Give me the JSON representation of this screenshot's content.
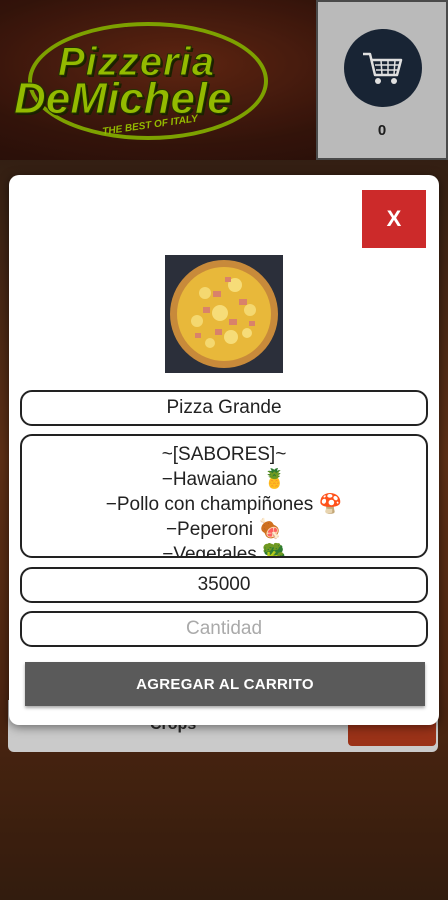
{
  "header": {
    "logo_line1": "Pizzeria",
    "logo_line2": "DeMichele",
    "logo_tagline": "THE BEST OF ITALY",
    "cart_count": "0"
  },
  "background": {
    "card_label": "Crops"
  },
  "modal": {
    "close_label": "X",
    "product_name": "Pizza Grande",
    "description_lines": [
      "~[SABORES]~",
      "−Hawaiano 🍍",
      "−Pollo con champiñones 🍄",
      "−Peperoni 🍖",
      "−Vegetales 🥦"
    ],
    "price": "35000",
    "quantity_placeholder": "Cantidad",
    "add_button_label": "AGREGAR AL CARRITO"
  },
  "colors": {
    "close_button": "#cc2a2a",
    "add_button": "#5a5a5a",
    "cart_circle": "#1c2a3c",
    "logo_green": "#a8d400"
  }
}
